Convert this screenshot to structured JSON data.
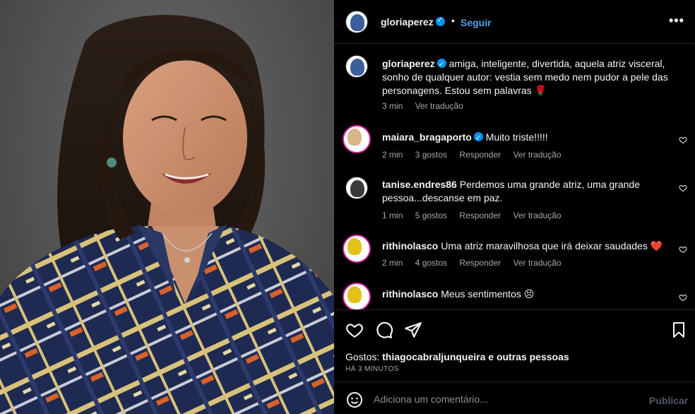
{
  "post": {
    "username": "gloriaperez",
    "dot": "•",
    "follow_label": "Seguir",
    "more_label": "•••"
  },
  "caption": {
    "username": "gloriaperez",
    "text": "amiga, inteligente, divertida, aquela atriz visceral, sonho de qualquer autor: vestia sem medo nem pudor a pele das personagens. Estou sem palavras 🌹",
    "time": "3 min",
    "translate": "Ver tradução"
  },
  "comments": [
    {
      "username": "maiara_bragaporto",
      "verified": true,
      "text": "Muito triste!!!!!",
      "time": "2 min",
      "likes": "3 gostos",
      "reply": "Responder",
      "translate": "Ver tradução"
    },
    {
      "username": "tanise.endres86",
      "verified": false,
      "text": "Perdemos uma grande atriz, uma grande pessoa...descanse em paz.",
      "time": "1 min",
      "likes": "5 gostos",
      "reply": "Responder",
      "translate": "Ver tradução"
    },
    {
      "username": "rithinolasco",
      "verified": false,
      "text": "Uma atriz maravilhosa que irá deixar saudades ❤️",
      "time": "2 min",
      "likes": "4 gostos",
      "reply": "Responder",
      "translate": "Ver tradução"
    },
    {
      "username": "rithinolasco",
      "verified": false,
      "text": "Meus sentimentos 😣",
      "time": "",
      "likes": "",
      "reply": "",
      "translate": ""
    }
  ],
  "likes": {
    "label": "Gostos:",
    "text": "thiagocabraljunqueira e outras pessoas"
  },
  "time_ago": "HÁ 3 MINUTOS",
  "add_comment": {
    "placeholder": "Adiciona um comentário...",
    "publish_label": "Publicar"
  },
  "icons": {
    "like": "heart-icon",
    "comment": "comment-icon",
    "share": "send-icon",
    "save": "bookmark-icon",
    "emoji": "emoji-icon",
    "verified": "verified-badge-icon"
  },
  "colors": {
    "link_blue": "#4aa3ef",
    "verified_blue": "#0095f6",
    "muted_text": "#a8a8a8",
    "divider": "#262626"
  }
}
